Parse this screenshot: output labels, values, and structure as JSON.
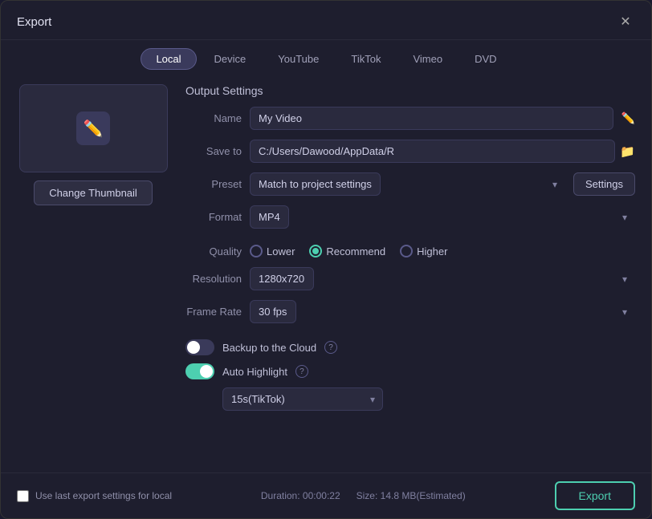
{
  "dialog": {
    "title": "Export",
    "close_label": "✕"
  },
  "tabs": [
    {
      "id": "local",
      "label": "Local",
      "active": true
    },
    {
      "id": "device",
      "label": "Device",
      "active": false
    },
    {
      "id": "youtube",
      "label": "YouTube",
      "active": false
    },
    {
      "id": "tiktok",
      "label": "TikTok",
      "active": false
    },
    {
      "id": "vimeo",
      "label": "Vimeo",
      "active": false
    },
    {
      "id": "dvd",
      "label": "DVD",
      "active": false
    }
  ],
  "thumbnail": {
    "change_label": "Change Thumbnail"
  },
  "output_settings": {
    "section_title": "Output Settings",
    "name_label": "Name",
    "name_value": "My Video",
    "save_to_label": "Save to",
    "save_to_value": "C:/Users/Dawood/AppData/R",
    "preset_label": "Preset",
    "preset_value": "Match to project settings",
    "settings_label": "Settings",
    "format_label": "Format",
    "format_value": "MP4",
    "quality_label": "Quality",
    "quality_options": [
      {
        "id": "lower",
        "label": "Lower",
        "selected": false
      },
      {
        "id": "recommend",
        "label": "Recommend",
        "selected": true
      },
      {
        "id": "higher",
        "label": "Higher",
        "selected": false
      }
    ],
    "resolution_label": "Resolution",
    "resolution_value": "1280x720",
    "frame_rate_label": "Frame Rate",
    "frame_rate_value": "30 fps"
  },
  "cloud": {
    "backup_label": "Backup to the Cloud",
    "backup_enabled": false,
    "auto_highlight_label": "Auto Highlight",
    "auto_highlight_enabled": true,
    "tiktok_duration": "15s(TikTok)"
  },
  "footer": {
    "use_last_settings_label": "Use last export settings for local",
    "duration_label": "Duration:",
    "duration_value": "00:00:22",
    "size_label": "Size:",
    "size_value": "14.8 MB(Estimated)",
    "export_label": "Export"
  }
}
